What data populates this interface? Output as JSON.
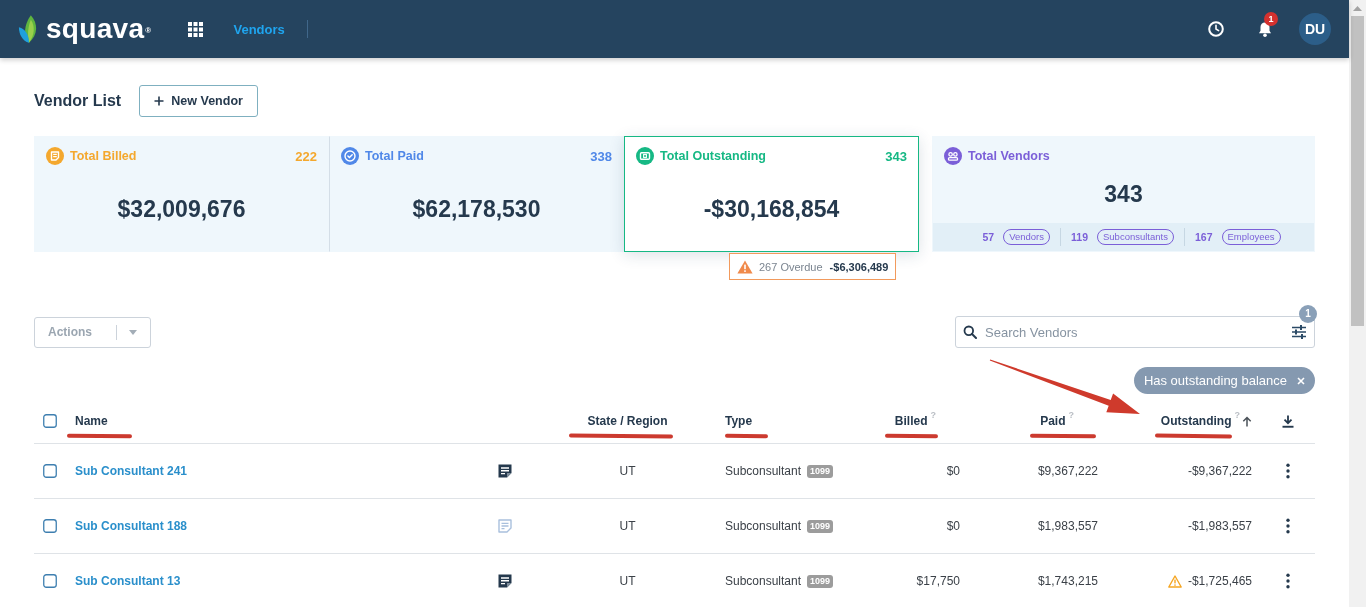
{
  "header": {
    "logo": "squava$^{®}$",
    "nav": [
      {
        "label": "Vendors",
        "selected": true
      }
    ],
    "notification_count": "1",
    "avatar_initials": "DU"
  },
  "page": {
    "title": "Vendor List",
    "new_button": "New Vendor"
  },
  "summary_cards": [
    {
      "kind": "billed",
      "title": "Total Billed",
      "count": "222",
      "value": "$32,009,676",
      "color": "#f4a82e",
      "selected": false
    },
    {
      "kind": "paid",
      "title": "Total Paid",
      "count": "338",
      "value": "$62,178,530",
      "color": "#5088e8",
      "selected": false
    },
    {
      "kind": "outstanding",
      "title": "Total Outstanding",
      "count": "343",
      "value": "-$30,168,854",
      "color": "#16b884",
      "selected": true,
      "overdue": {
        "label": "267 Overdue",
        "amount": "-$6,306,489"
      }
    },
    {
      "kind": "vendors",
      "title": "Total Vendors",
      "value": "343",
      "color": "#7b5fd8",
      "selected": false,
      "breakdown": [
        {
          "count": "57",
          "label": "Vendors"
        },
        {
          "count": "119",
          "label": "Subconsultants"
        },
        {
          "count": "167",
          "label": "Employees"
        }
      ]
    }
  ],
  "toolbar": {
    "actions": {
      "label": "Actions",
      "disabled": true
    },
    "search": {
      "placeholder": "Search Vendors"
    },
    "filter_count": "1",
    "filter_chips": [
      {
        "label": "Has outstanding balance"
      }
    ]
  },
  "table": {
    "select_all_checked": false,
    "columns": [
      {
        "label": "Name",
        "sorted": false,
        "underlined": true
      },
      {
        "label": "State / Region",
        "sorted": false,
        "underlined": true
      },
      {
        "label": "Type",
        "sorted": false,
        "underlined": true
      },
      {
        "label": "Billed",
        "hint": "?",
        "sorted": false,
        "underlined": true
      },
      {
        "label": "Paid",
        "hint": "?",
        "sorted": false,
        "underlined": true
      },
      {
        "label": "Outstanding",
        "hint": "?",
        "sorted": true,
        "underlined": true
      }
    ],
    "rows": [
      {
        "checked": false,
        "name": "Sub Consultant 241",
        "has_notes": true,
        "state": "UT",
        "type": "Subconsultant",
        "tax_form": "1099",
        "billed": "$0",
        "paid": "$9,367,222",
        "outstanding": "-$9,367,222",
        "overdue": false
      },
      {
        "checked": false,
        "name": "Sub Consultant 188",
        "has_notes": false,
        "state": "UT",
        "type": "Subconsultant",
        "tax_form": "1099",
        "billed": "$0",
        "paid": "$1,983,557",
        "outstanding": "-$1,983,557",
        "overdue": false
      },
      {
        "checked": false,
        "name": "Sub Consultant 13",
        "has_notes": true,
        "state": "UT",
        "type": "Subconsultant",
        "tax_form": "1099",
        "billed": "$17,750",
        "paid": "$1,743,215",
        "outstanding": "-$1,725,465",
        "overdue": true
      }
    ]
  },
  "annotations": {
    "arrow": true
  }
}
